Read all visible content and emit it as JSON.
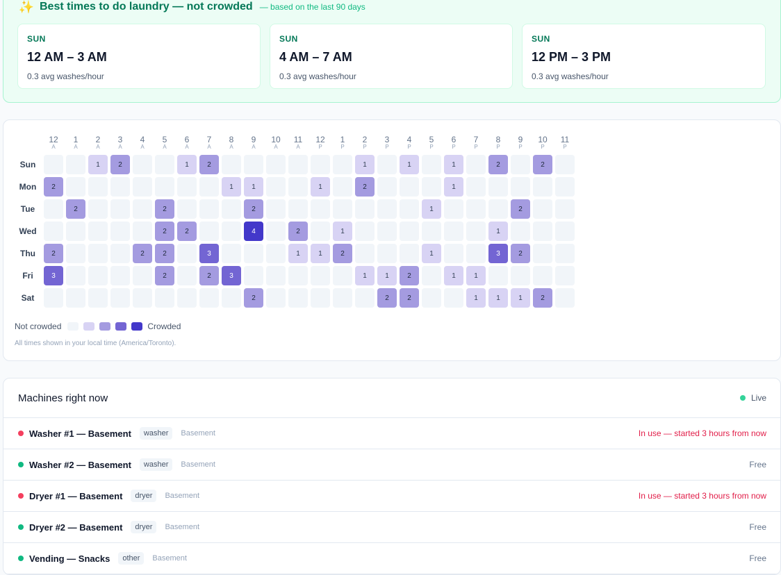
{
  "best_times": {
    "title": "Best times to do laundry — not crowded",
    "subtitle": "— based on the last 90 days",
    "icon": "sparkles-icon",
    "slots": [
      {
        "day": "SUN",
        "range": "12 AM – 3 AM",
        "avg": "0.3 avg washes/hour"
      },
      {
        "day": "SUN",
        "range": "4 AM – 7 AM",
        "avg": "0.3 avg washes/hour"
      },
      {
        "day": "SUN",
        "range": "12 PM – 3 PM",
        "avg": "0.3 avg washes/hour"
      }
    ]
  },
  "heatmap": {
    "hours": [
      "12",
      "1",
      "2",
      "3",
      "4",
      "5",
      "6",
      "7",
      "8",
      "9",
      "10",
      "11",
      "12",
      "1",
      "2",
      "3",
      "4",
      "5",
      "6",
      "7",
      "8",
      "9",
      "10",
      "11"
    ],
    "ampm": [
      "A",
      "A",
      "A",
      "A",
      "A",
      "A",
      "A",
      "A",
      "A",
      "A",
      "A",
      "A",
      "P",
      "P",
      "P",
      "P",
      "P",
      "P",
      "P",
      "P",
      "P",
      "P",
      "P",
      "P"
    ],
    "days": [
      "Sun",
      "Mon",
      "Tue",
      "Wed",
      "Thu",
      "Fri",
      "Sat"
    ],
    "values": [
      [
        0,
        0,
        1,
        2,
        0,
        0,
        1,
        2,
        0,
        0,
        0,
        0,
        0,
        0,
        1,
        0,
        1,
        0,
        1,
        0,
        2,
        0,
        2,
        0
      ],
      [
        2,
        0,
        0,
        0,
        0,
        0,
        0,
        0,
        1,
        1,
        0,
        0,
        1,
        0,
        2,
        0,
        0,
        0,
        1,
        0,
        0,
        0,
        0,
        0
      ],
      [
        0,
        2,
        0,
        0,
        0,
        2,
        0,
        0,
        0,
        2,
        0,
        0,
        0,
        0,
        0,
        0,
        0,
        1,
        0,
        0,
        0,
        2,
        0,
        0
      ],
      [
        0,
        0,
        0,
        0,
        0,
        2,
        2,
        0,
        0,
        4,
        0,
        2,
        0,
        1,
        0,
        0,
        0,
        0,
        0,
        0,
        1,
        0,
        0,
        0
      ],
      [
        2,
        0,
        0,
        0,
        2,
        2,
        0,
        3,
        0,
        0,
        0,
        1,
        1,
        2,
        0,
        0,
        0,
        1,
        0,
        0,
        3,
        2,
        0,
        0
      ],
      [
        3,
        0,
        0,
        0,
        0,
        2,
        0,
        2,
        3,
        0,
        0,
        0,
        0,
        0,
        1,
        1,
        2,
        0,
        1,
        1,
        0,
        0,
        0,
        0
      ],
      [
        0,
        0,
        0,
        0,
        0,
        0,
        0,
        0,
        0,
        2,
        0,
        0,
        0,
        0,
        0,
        2,
        2,
        0,
        0,
        1,
        1,
        1,
        2,
        0
      ]
    ],
    "legend": {
      "low": "Not crowded",
      "high": "Crowded"
    },
    "colors": [
      "#f1f5f9",
      "#d8d3f4",
      "#a49be0",
      "#7365d3",
      "#4338ca"
    ],
    "note": "All times shown in your local time (America/Toronto)."
  },
  "machines": {
    "title": "Machines right now",
    "live_label": "Live",
    "items": [
      {
        "name": "Washer #1 — Basement",
        "type": "washer",
        "location": "Basement",
        "status": "In use — started 3 hours from now",
        "state": "busy"
      },
      {
        "name": "Washer #2 — Basement",
        "type": "washer",
        "location": "Basement",
        "status": "Free",
        "state": "free"
      },
      {
        "name": "Dryer #1 — Basement",
        "type": "dryer",
        "location": "Basement",
        "status": "In use — started 3 hours from now",
        "state": "busy"
      },
      {
        "name": "Dryer #2 — Basement",
        "type": "dryer",
        "location": "Basement",
        "status": "Free",
        "state": "free"
      },
      {
        "name": "Vending — Snacks",
        "type": "other",
        "location": "Basement",
        "status": "Free",
        "state": "free"
      }
    ]
  }
}
